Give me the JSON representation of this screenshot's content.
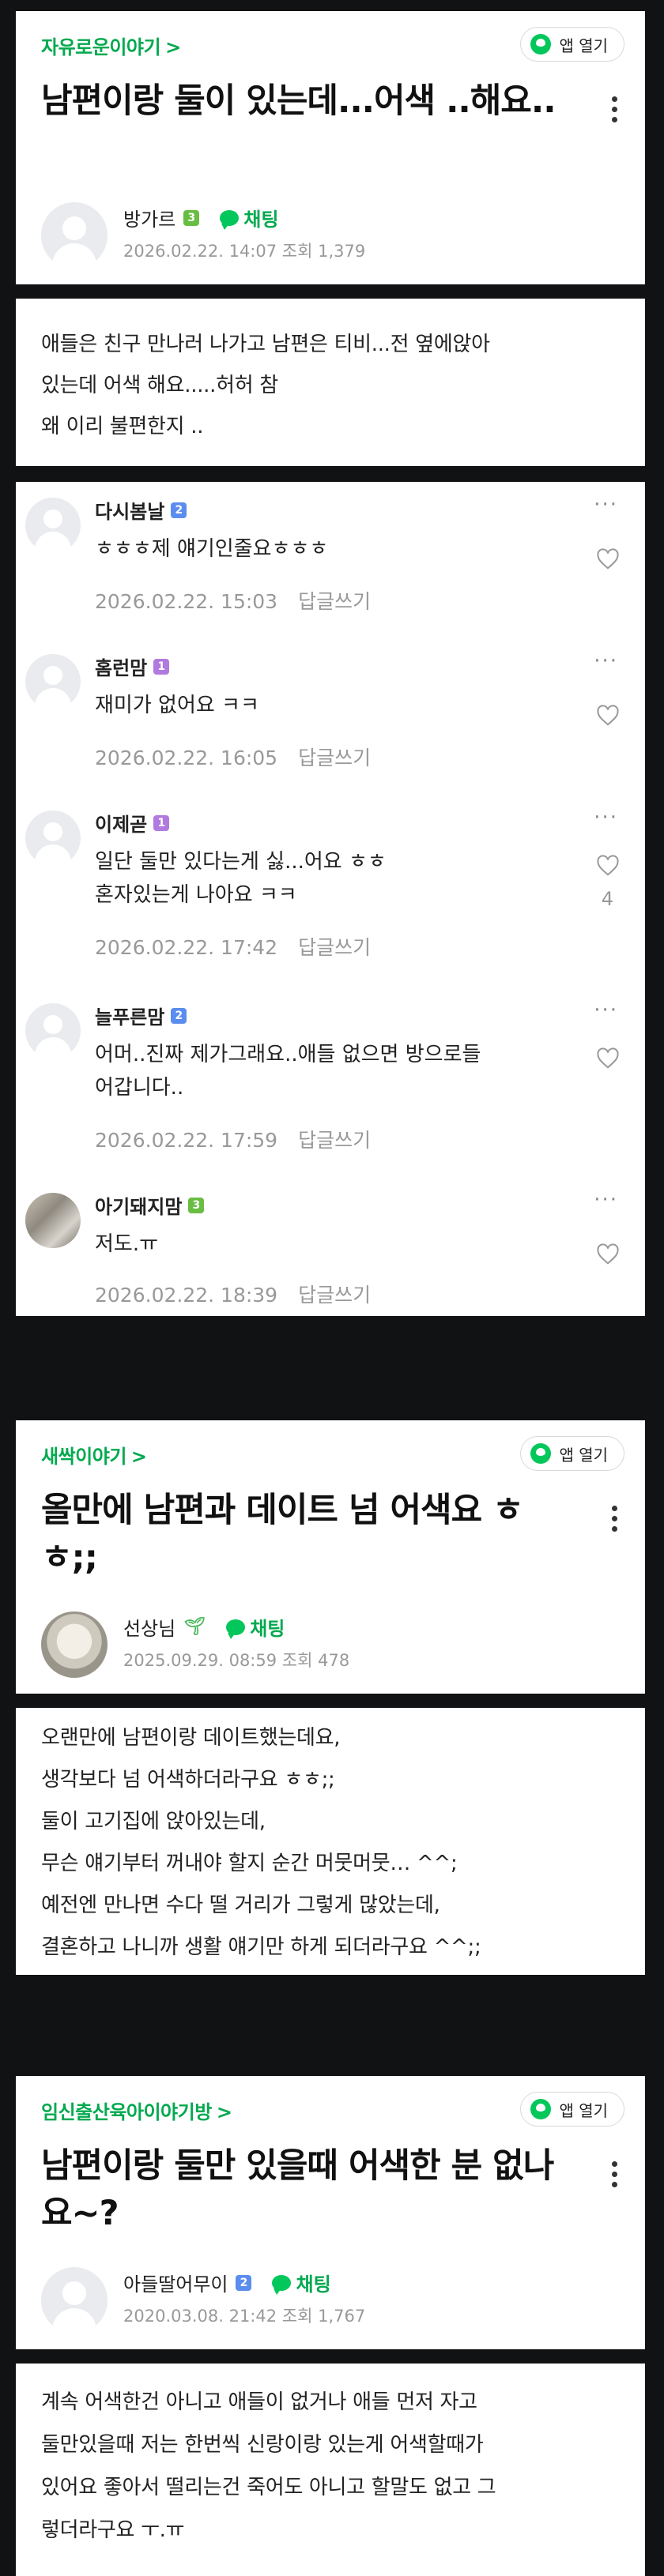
{
  "app_button_label": "앱 열기",
  "reply_label": "답글쓰기",
  "posts": [
    {
      "category": "자유로운이야기",
      "title": "남편이랑 둘이 있는데...어색 ..해요..",
      "author": "방가르",
      "badge": "3",
      "chat_label": "채팅",
      "meta": "2026.02.22. 14:07  조회 1,379",
      "body": [
        "애들은 친구  만나러  나가고  남편은  티비...전  옆에앉아",
        " 있는데  어색  해요.....허허  참",
        "왜 이리  불편한지  .."
      ]
    },
    {
      "category": "새싹이야기",
      "title": "올만에 남편과 데이트 넘 어색요 ㅎㅎ;;",
      "author": "선상님",
      "chat_label": "채팅",
      "meta": "2025.09.29. 08:59  조회 478",
      "body": [
        "오랜만에 남편이랑 데이트했는데요,",
        "생각보다 넘 어색하더라구요 ㅎㅎ;;",
        "둘이 고기집에 앉아있는데,",
        "무슨 얘기부터 꺼내야 할지 순간 머뭇머뭇… ^^;",
        "예전엔 만나면 수다 떨 거리가 그렇게 많았는데,",
        "결혼하고 나니까 생활 얘기만 하게 되더라구요 ^^;;"
      ]
    },
    {
      "category": "임신출산육아이야기방",
      "title": "남편이랑 둘만 있을때 어색한 분 없나요~?",
      "author": "아들딸어무이",
      "badge": "2",
      "chat_label": "채팅",
      "meta": "2020.03.08. 21:42  조회 1,767",
      "body": [
        "계속 어색한건 아니고 애들이 없거나 애들 먼저 자고",
        "둘만있을때 저는 한번씩 신랑이랑 있는게 어색할때가",
        "있어요 좋아서 떨리는건 죽어도 아니고 할말도 없고 그",
        "렇더라구요 ㅜ.ㅠ"
      ]
    }
  ],
  "comments": [
    {
      "name": "다시봄날",
      "badge": "2",
      "text": [
        "ㅎㅎㅎ제 얘기인줄요ㅎㅎㅎ"
      ],
      "date": "2026.02.22. 15:03"
    },
    {
      "name": "홈런맘",
      "badge": "1",
      "text": [
        "재미가 없어요 ㅋㅋ"
      ],
      "date": "2026.02.22. 16:05"
    },
    {
      "name": "이제곧",
      "badge": "1",
      "text": [
        "일단 둘만 있다는게 싫...어요 ㅎㅎ",
        "혼자있는게 나아요 ㅋㅋ"
      ],
      "date": "2026.02.22. 17:42",
      "likes": "4"
    },
    {
      "name": "늘푸른맘",
      "badge": "2",
      "text": [
        "어머..진짜 제가그래요..애들 없으면 방으로들",
        "어갑니다.."
      ],
      "date": "2026.02.22. 17:59"
    },
    {
      "name": "아기돼지맘",
      "badge": "3",
      "text": [
        "저도.ㅠ"
      ],
      "date": "2026.02.22. 18:39"
    }
  ]
}
